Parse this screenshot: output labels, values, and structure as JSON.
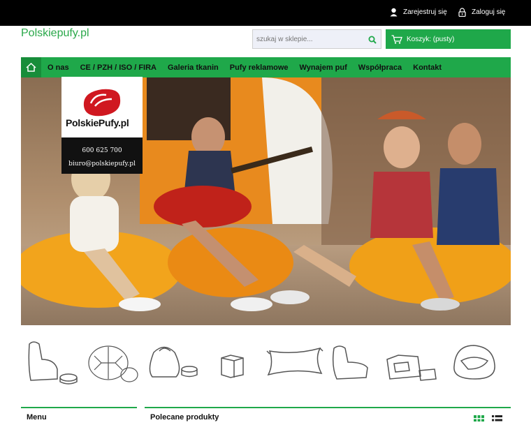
{
  "topbar": {
    "register_label": "Zarejestruj się",
    "login_label": "Zaloguj się"
  },
  "header": {
    "brand": "Polskiepufy.pl",
    "search_placeholder": "szukaj w sklepie...",
    "cart_label": "Koszyk: (pusty)"
  },
  "nav": {
    "items": [
      {
        "label": "O nas"
      },
      {
        "label": "CE / PZH / ISO / FIRA"
      },
      {
        "label": "Galeria tkanin"
      },
      {
        "label": "Pufy reklamowe"
      },
      {
        "label": "Wynajem puf"
      },
      {
        "label": "Współpraca"
      },
      {
        "label": "Kontakt"
      }
    ]
  },
  "hero": {
    "logo_text": "PolskiePufy.pl",
    "phone": "600 625 700",
    "email": "biuro@polskiepufy.pl"
  },
  "bottom": {
    "menu_label": "Menu",
    "recommended_label": "Polecane produkty"
  },
  "colors": {
    "accent": "#1fa84a",
    "topbar": "#000000"
  }
}
